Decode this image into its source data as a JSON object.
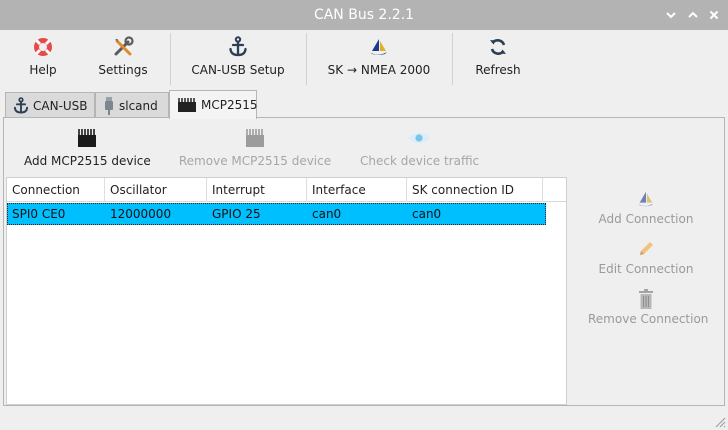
{
  "window": {
    "title": "CAN Bus 2.2.1"
  },
  "toolbar": {
    "help": "Help",
    "settings": "Settings",
    "can_usb_setup": "CAN-USB Setup",
    "sk_nmea": "SK → NMEA 2000",
    "refresh": "Refresh"
  },
  "tabs": [
    {
      "label": "CAN-USB",
      "icon": "anchor-icon"
    },
    {
      "label": "slcand",
      "icon": "usb-plug-icon"
    },
    {
      "label": "MCP2515",
      "icon": "chip-icon",
      "active": true
    }
  ],
  "device_actions": {
    "add": "Add MCP2515 device",
    "remove": "Remove MCP2515 device",
    "check": "Check device traffic"
  },
  "table": {
    "columns": [
      "Connection",
      "Oscillator",
      "Interrupt",
      "Interface",
      "SK connection ID"
    ],
    "rows": [
      [
        "SPI0 CE0",
        "12000000",
        "GPIO 25",
        "can0",
        "can0"
      ]
    ]
  },
  "connection_actions": {
    "add": "Add Connection",
    "edit": "Edit Connection",
    "remove": "Remove Connection"
  },
  "colors": {
    "title_bar": "#b3b3b3",
    "selected_row": "#00bfff",
    "disabled_text": "#a6a6a6"
  }
}
